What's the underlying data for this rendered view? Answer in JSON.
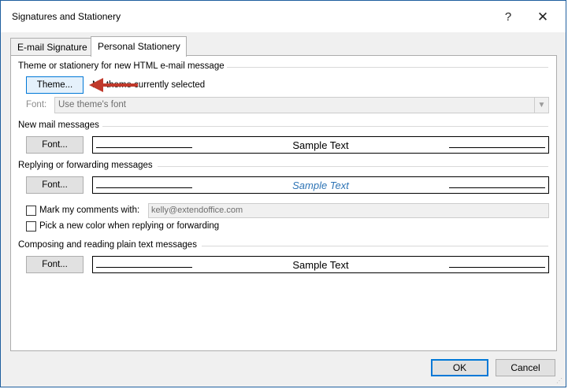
{
  "window": {
    "title": "Signatures and Stationery",
    "help_glyph": "?",
    "close_glyph": "✕"
  },
  "tabs": [
    {
      "label": "E-mail Signature",
      "active": false
    },
    {
      "label": "Personal Stationery",
      "active": true
    }
  ],
  "theme_section": {
    "heading": "Theme or stationery for new HTML e-mail message",
    "theme_button": "Theme...",
    "status": "No theme currently selected",
    "font_label": "Font:",
    "font_select_value": "Use theme's font"
  },
  "new_mail": {
    "heading": "New mail messages",
    "font_button": "Font...",
    "sample_text": "Sample Text"
  },
  "reply_forward": {
    "heading": "Replying or forwarding messages",
    "font_button": "Font...",
    "sample_text": "Sample Text",
    "mark_comments_label": "Mark my comments with:",
    "mark_comments_checked": false,
    "mark_comments_value": "kelly@extendoffice.com",
    "pick_color_label": "Pick a new color when replying or forwarding",
    "pick_color_checked": false
  },
  "plain_text": {
    "heading": "Composing and reading plain text messages",
    "font_button": "Font...",
    "sample_text": "Sample Text"
  },
  "footer": {
    "ok": "OK",
    "cancel": "Cancel"
  },
  "colors": {
    "accent": "#0078d7",
    "annotation_arrow": "#c0392b",
    "reply_sample_text": "#2e74b5"
  }
}
